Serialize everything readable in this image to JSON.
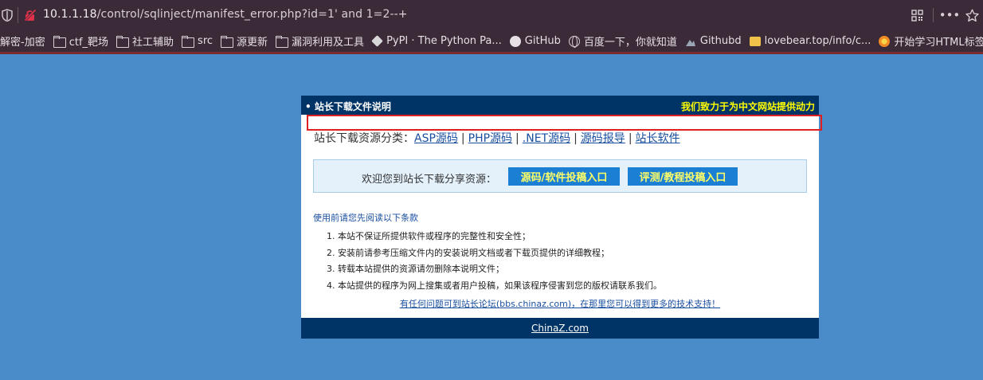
{
  "browser": {
    "url_host": "10.1.1.18",
    "url_path": "/control/sqlinject/manifest_error.php?id=1' and 1=2--+",
    "bookmarks": [
      {
        "label": "解密-加密",
        "icon": "none"
      },
      {
        "label": "ctf_靶场",
        "icon": "folder"
      },
      {
        "label": "社工辅助",
        "icon": "folder"
      },
      {
        "label": "src",
        "icon": "folder"
      },
      {
        "label": "源更新",
        "icon": "folder"
      },
      {
        "label": "漏洞利用及工具",
        "icon": "folder"
      },
      {
        "label": "PyPI · The Python Pa...",
        "icon": "pypi"
      },
      {
        "label": "GitHub",
        "icon": "github"
      },
      {
        "label": "百度一下，你就知道",
        "icon": "globe"
      },
      {
        "label": "Githubd",
        "icon": "mountain"
      },
      {
        "label": "lovebear.top/info/c...",
        "icon": "box"
      },
      {
        "label": "开始学习HTML标签 | ...",
        "icon": "html"
      }
    ],
    "icons": [
      "shield-icon",
      "insecure-lock-icon",
      "qr-code-icon",
      "more-icon",
      "star-icon"
    ]
  },
  "page": {
    "header_title": "• 站长下载文件说明",
    "header_slogan": "我们致力于为中文网站提供动力",
    "categories_label": "站长下载资源分类：",
    "categories": [
      "ASP源码",
      "PHP源码",
      ".NET源码",
      "源码报导",
      "站长软件"
    ],
    "welcome_text": "欢迎您到站长下载分享资源：",
    "submit_source_button": "源码/软件投稿入口",
    "submit_review_button": "评测/教程投稿入口",
    "notice_heading": "使用前请您先阅读以下条款",
    "rules": [
      "1. 本站不保证所提供软件或程序的完整性和安全性；",
      "2. 安装前请参考压缩文件内的安装说明文档或者下载页提供的详细教程；",
      "3. 转载本站提供的资源请勿删除本说明文件；",
      "4. 本站提供的程序为网上搜集或者用户投稿，如果该程序侵害到您的版权请联系我们。"
    ],
    "help_link": "有任何问题可到站长论坛(bbs.chinaz.com)，在那里您可以得到更多的技术支持！",
    "footer_link": "ChinaZ.com"
  },
  "colors": {
    "page_bg": "#4a8bc9",
    "header_bg": "#003366",
    "slogan": "#ffff00",
    "button_bg": "#1b7fd4",
    "highlight_box": "#e02020"
  }
}
